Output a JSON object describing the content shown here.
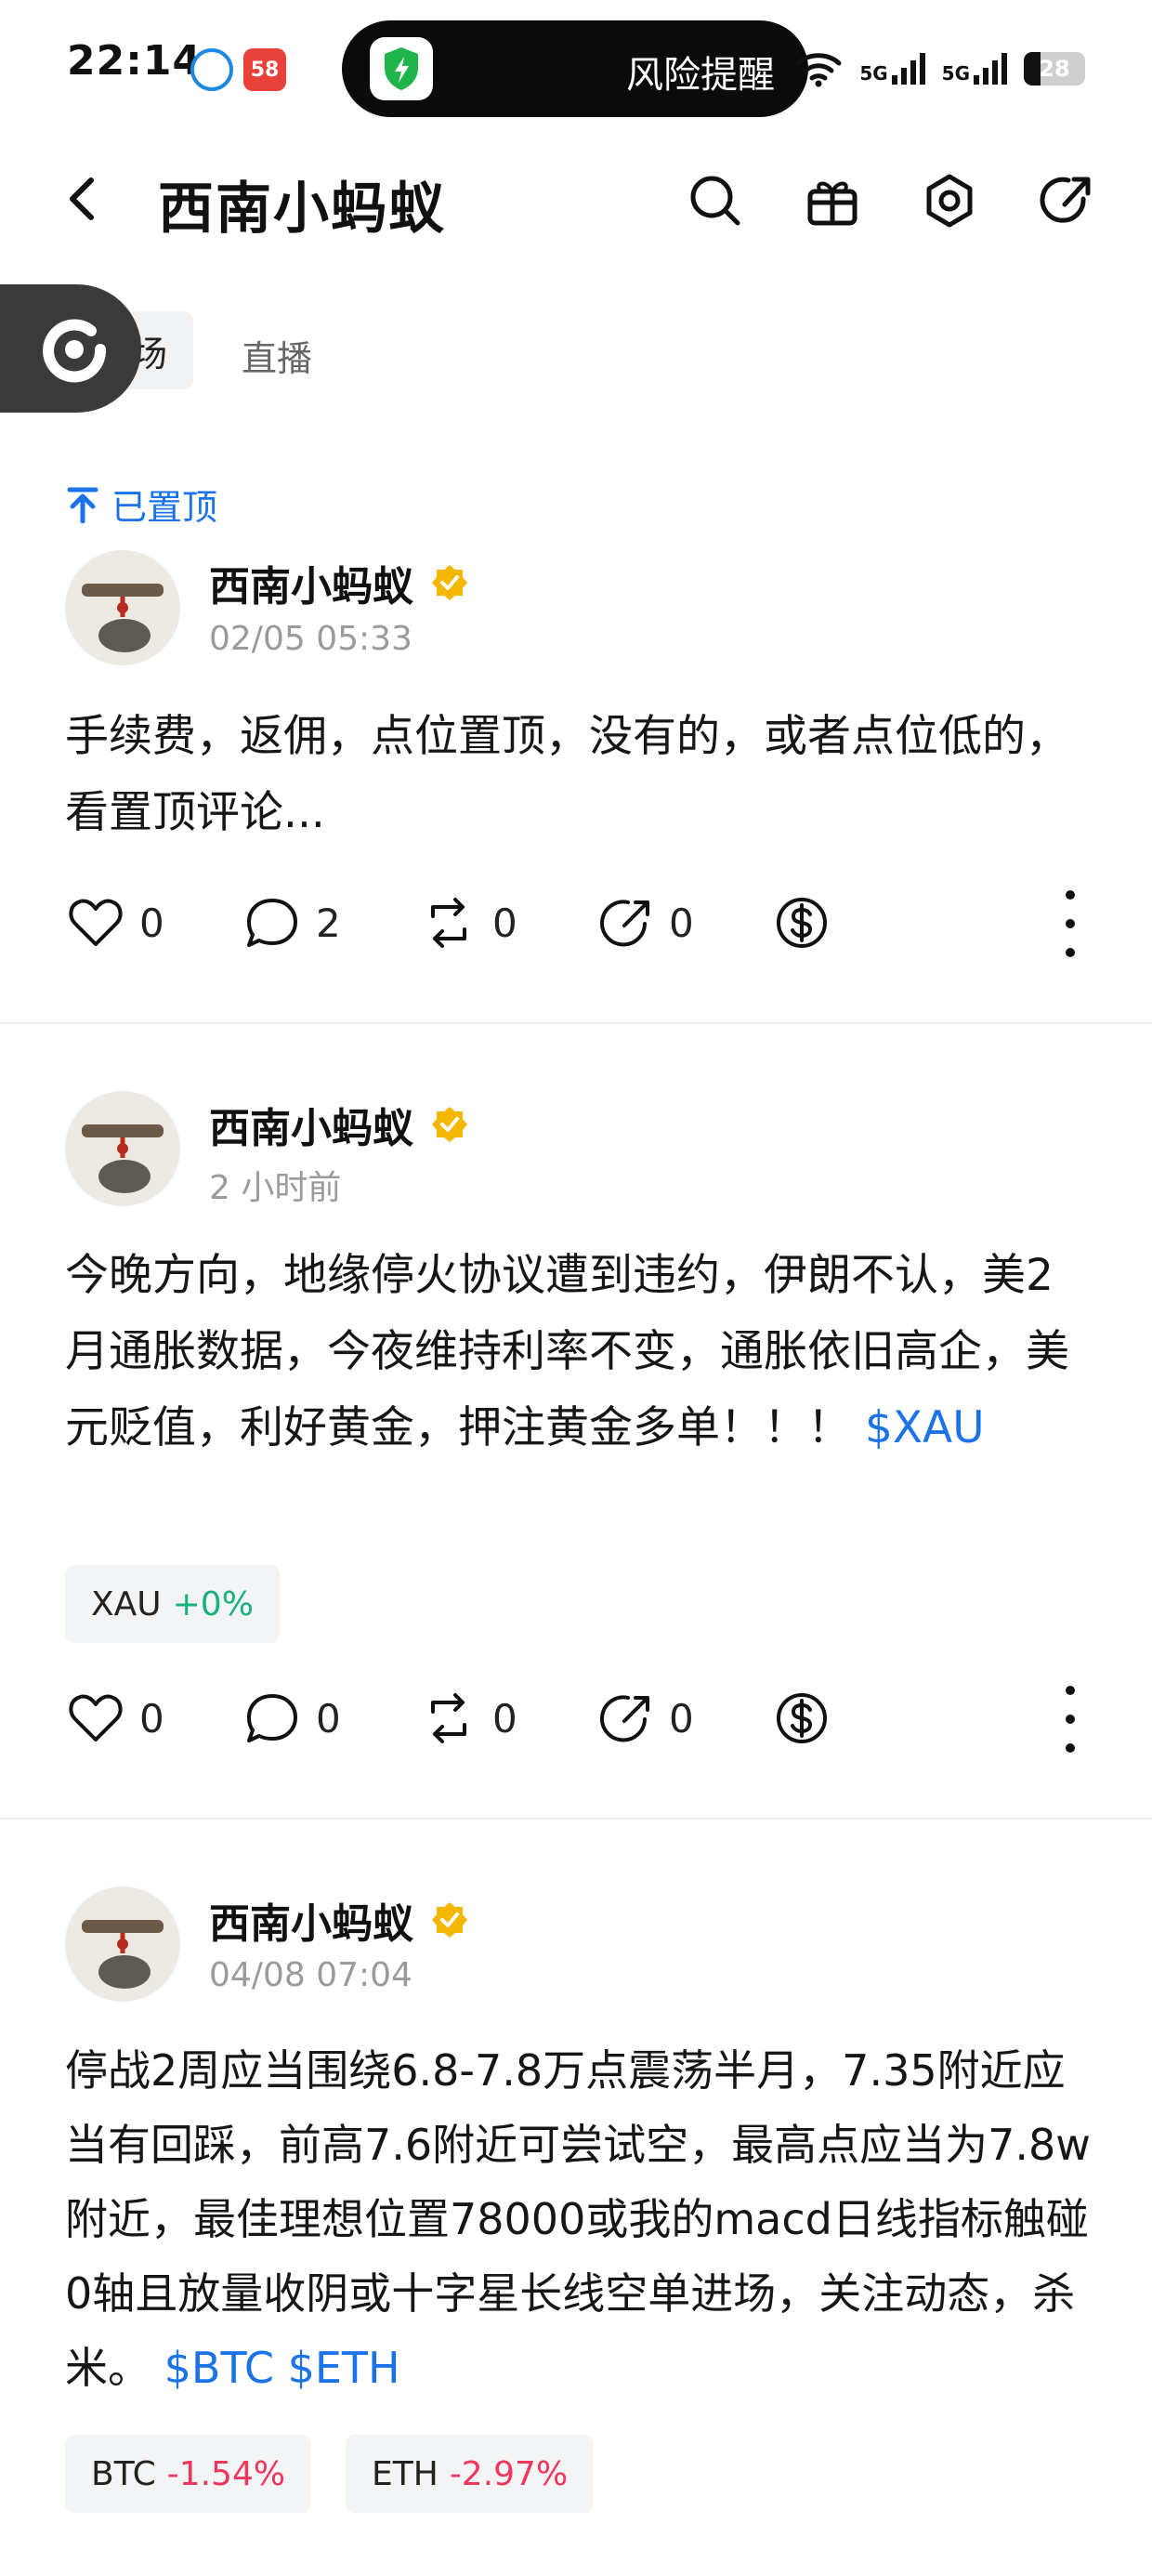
{
  "status_bar": {
    "time": "22:14",
    "app_badge_2": "58",
    "island_text": "风险提醒",
    "net_label_1": "5G",
    "net_label_2": "5G",
    "battery": "28",
    "battery_level": 0.28
  },
  "header": {
    "title": "西南小蚂蚁",
    "icons": [
      "back-icon",
      "search-icon",
      "gift-icon",
      "settings-hexagon-icon",
      "share-icon"
    ]
  },
  "tabs": {
    "square": "广场",
    "live": "直播",
    "active": "square"
  },
  "posts": [
    {
      "pinned_label": "已置顶",
      "author": "西南小蚂蚁",
      "time": "02/05 05:33",
      "text": "手续费，返佣，点位置顶，没有的，或者点位低的，看置顶评论...",
      "tags": "",
      "likes": "0",
      "comments": "2",
      "reposts": "0",
      "shares": "0"
    },
    {
      "author": "西南小蚂蚁",
      "time": "2 小时前",
      "text": "今晚方向，地缘停火协议遭到违约，伊朗不认，美2月通胀数据，今夜维持利率不变，通胀依旧高企，美元贬值，利好黄金，押注黄金多单！！！",
      "tags": "$XAU",
      "chips": [
        {
          "symbol": "XAU",
          "change": "+0%",
          "direction": "up"
        }
      ],
      "likes": "0",
      "comments": "0",
      "reposts": "0",
      "shares": "0"
    },
    {
      "author": "西南小蚂蚁",
      "time": "04/08 07:04",
      "text": "停战2周应当围绕6.8-7.8万点震荡半月，7.35附近应当有回踩，前高7.6附近可尝试空，最高点应当为7.8w附近，最佳理想位置78000或我的macd日线指标触碰0轴且放量收阴或十字星长线空单进场，关注动态，杀米。",
      "tags": "$BTC $ETH",
      "chips": [
        {
          "symbol": "BTC",
          "change": "-1.54%",
          "direction": "down"
        },
        {
          "symbol": "ETH",
          "change": "-2.97%",
          "direction": "down"
        }
      ]
    }
  ],
  "colors": {
    "link": "#1a73e8",
    "up": "#16b17e",
    "down": "#f0365b",
    "verified": "#f5b700"
  }
}
